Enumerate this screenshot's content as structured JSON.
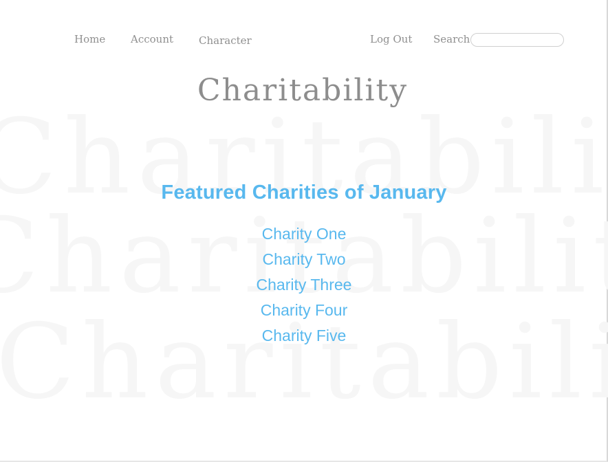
{
  "nav": {
    "home": "Home",
    "account": "Account",
    "character": "Character",
    "logout": "Log Out",
    "search_label": "Search",
    "search_value": "",
    "search_placeholder": ""
  },
  "site": {
    "title": "Charitability",
    "watermark_text": "CharitabilityCharitabilityCharitability"
  },
  "featured": {
    "heading": "Featured Charities of January",
    "charities": [
      {
        "label": "Charity One"
      },
      {
        "label": "Charity Two"
      },
      {
        "label": "Charity Three"
      },
      {
        "label": "Charity Four"
      },
      {
        "label": "Charity Five"
      }
    ]
  },
  "colors": {
    "accent": "#58b8ee",
    "nav_text": "#8f8f8f",
    "title_text": "#8d8d8d",
    "watermark": "#f6f6f6"
  }
}
